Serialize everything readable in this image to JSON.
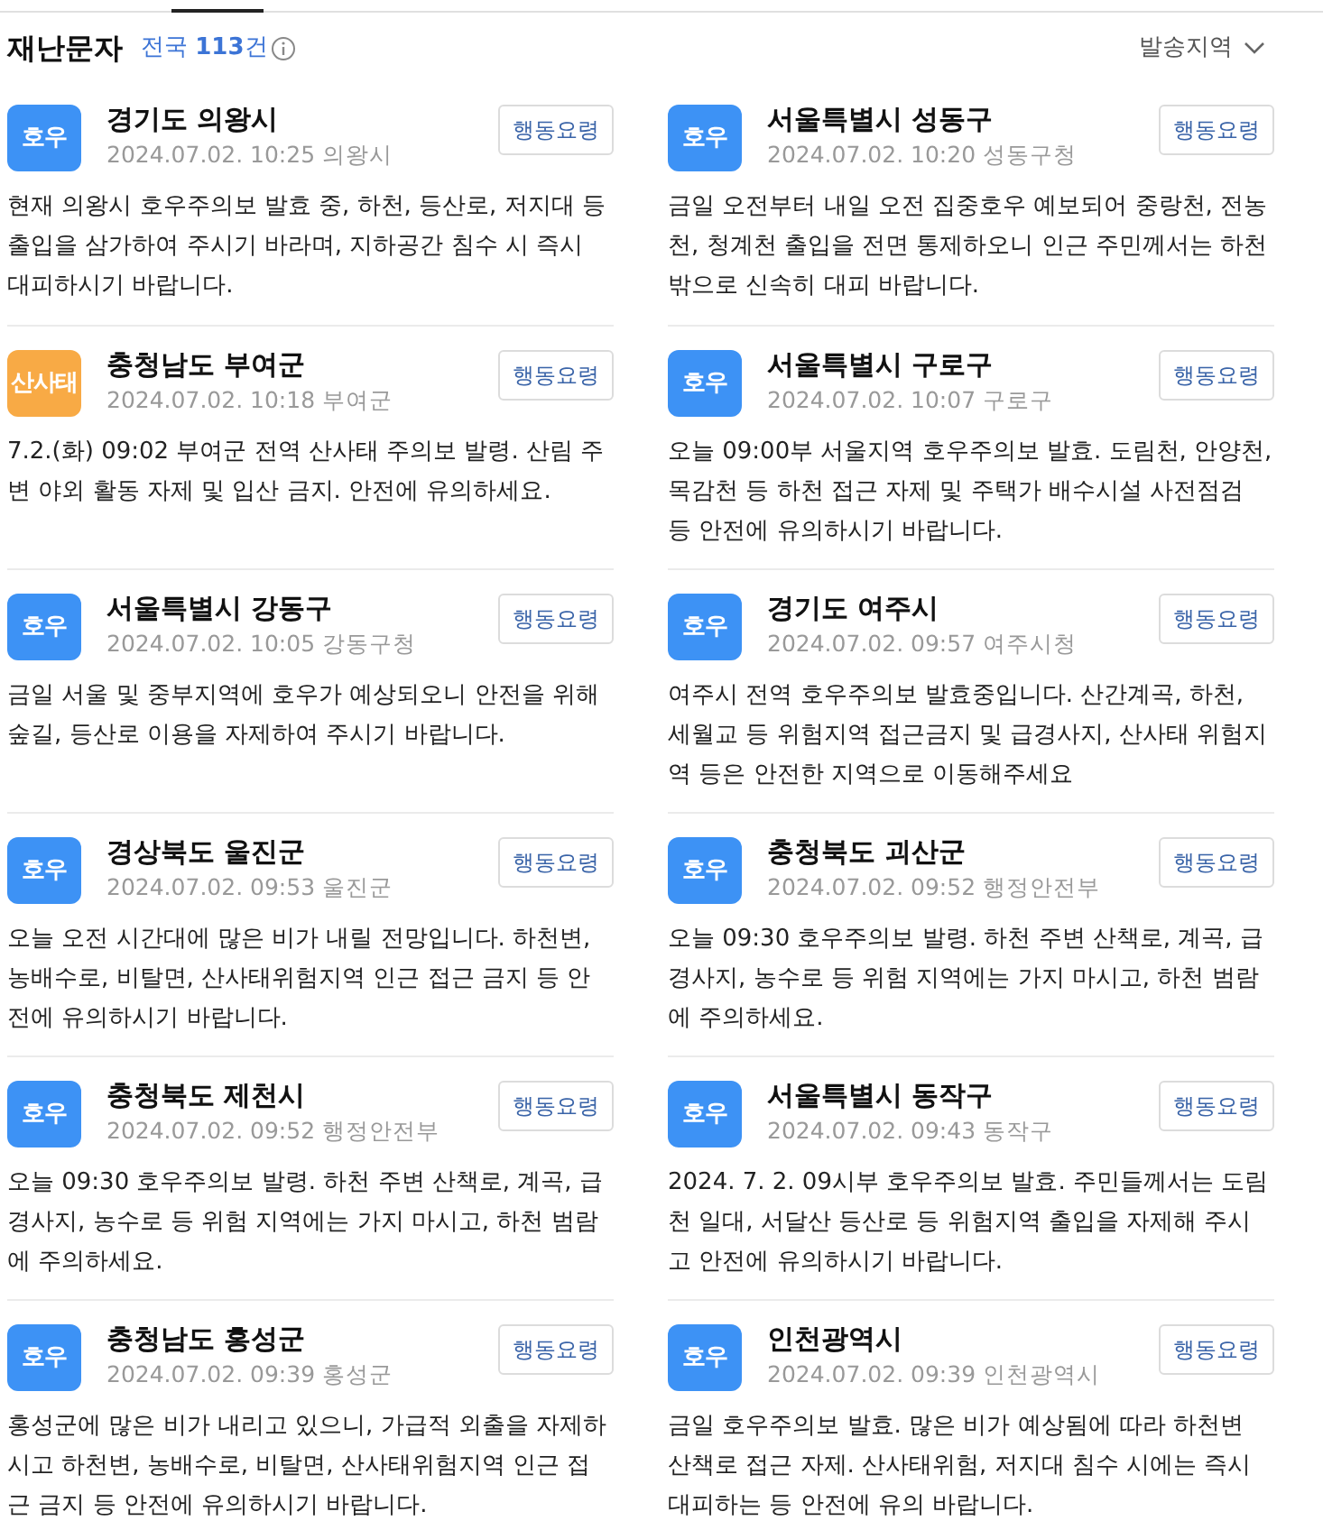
{
  "header": {
    "title": "재난문자",
    "count": "전국 **113**건",
    "filter": "발송지역"
  },
  "messages": [
    {
      "badge": "호우",
      "color": "#3d92f5",
      "region": "경기도 의왕시",
      "meta": "2024.07.02. 10:25 의왕시",
      "action": "행동요령",
      "body": "현재 의왕시 호우주의보 발효 중, 하천, 등산로, 저지대 등 출입을 삼가하여 주시기 바라며, 지하공간 침수 시 즉시 대피하시기 바랍니다."
    },
    {
      "badge": "호우",
      "color": "#3d92f5",
      "region": "서울특별시 성동구",
      "meta": "2024.07.02. 10:20 성동구청",
      "action": "행동요령",
      "body": "금일 오전부터 내일 오전 집중호우 예보되어 중랑천, 전농천, 청계천 출입을 전면 통제하오니 인근 주민께서는 하천 밖으로 신속히 대피 바랍니다."
    },
    {
      "badge": "산사태",
      "color": "#f8aa45",
      "region": "충청남도 부여군",
      "meta": "2024.07.02. 10:18 부여군",
      "action": "행동요령",
      "body": "7.2.(화) 09:02 부여군 전역 산사태 주의보 발령. 산림 주변 야외 활동 자제 및 입산 금지. 안전에 유의하세요."
    },
    {
      "badge": "호우",
      "color": "#3d92f5",
      "region": "서울특별시 구로구",
      "meta": "2024.07.02. 10:07 구로구",
      "action": "행동요령",
      "body": "오늘 09:00부 서울지역 호우주의보 발효. 도림천, 안양천, 목감천 등 하천 접근 자제 및 주택가 배수시설 사전점검 등 안전에 유의하시기 바랍니다."
    },
    {
      "badge": "호우",
      "color": "#3d92f5",
      "region": "서울특별시 강동구",
      "meta": "2024.07.02. 10:05 강동구청",
      "action": "행동요령",
      "body": "금일 서울 및 중부지역에 호우가 예상되오니 안전을 위해 숲길, 등산로 이용을 자제하여 주시기 바랍니다."
    },
    {
      "badge": "호우",
      "color": "#3d92f5",
      "region": "경기도 여주시",
      "meta": "2024.07.02. 09:57 여주시청",
      "action": "행동요령",
      "body": "여주시 전역 호우주의보 발효중입니다. 산간계곡, 하천, 세월교 등 위험지역 접근금지 및 급경사지, 산사태 위험지역 등은 안전한 지역으로 이동해주세요"
    },
    {
      "badge": "호우",
      "color": "#3d92f5",
      "region": "경상북도 울진군",
      "meta": "2024.07.02. 09:53 울진군",
      "action": "행동요령",
      "body": "오늘 오전 시간대에 많은 비가 내릴 전망입니다. 하천변, 농배수로, 비탈면, 산사태위험지역 인근 접근 금지 등 안전에 유의하시기 바랍니다."
    },
    {
      "badge": "호우",
      "color": "#3d92f5",
      "region": "충청북도 괴산군",
      "meta": "2024.07.02. 09:52 행정안전부",
      "action": "행동요령",
      "body": "오늘 09:30 호우주의보 발령. 하천 주변 산책로, 계곡, 급경사지, 농수로 등 위험 지역에는 가지 마시고, 하천 범람에 주의하세요."
    },
    {
      "badge": "호우",
      "color": "#3d92f5",
      "region": "충청북도 제천시",
      "meta": "2024.07.02. 09:52 행정안전부",
      "action": "행동요령",
      "body": "오늘 09:30 호우주의보 발령. 하천 주변 산책로, 계곡, 급경사지, 농수로 등 위험 지역에는 가지 마시고, 하천 범람에 주의하세요."
    },
    {
      "badge": "호우",
      "color": "#3d92f5",
      "region": "서울특별시 동작구",
      "meta": "2024.07.02. 09:43 동작구",
      "action": "행동요령",
      "body": "2024. 7. 2. 09시부 호우주의보 발효. 주민들께서는 도림천 일대, 서달산 등산로 등 위험지역 출입을 자제해 주시고 안전에 유의하시기 바랍니다."
    },
    {
      "badge": "호우",
      "color": "#3d92f5",
      "region": "충청남도 홍성군",
      "meta": "2024.07.02. 09:39 홍성군",
      "action": "행동요령",
      "body": "홍성군에 많은 비가 내리고 있으니, 가급적 외출을 자제하시고 하천변, 농배수로, 비탈면, 산사태위험지역 인근 접근 금지 등 안전에 유의하시기 바랍니다."
    },
    {
      "badge": "호우",
      "color": "#3d92f5",
      "region": "인천광역시",
      "meta": "2024.07.02. 09:39 인천광역시",
      "action": "행동요령",
      "body": "금일 호우주의보 발효. 많은 비가 예상됨에 따라 하천변 산책로 접근 자제. 산사태위험, 저지대 침수 시에는 즉시 대피하는 등 안전에 유의 바랍니다."
    }
  ]
}
